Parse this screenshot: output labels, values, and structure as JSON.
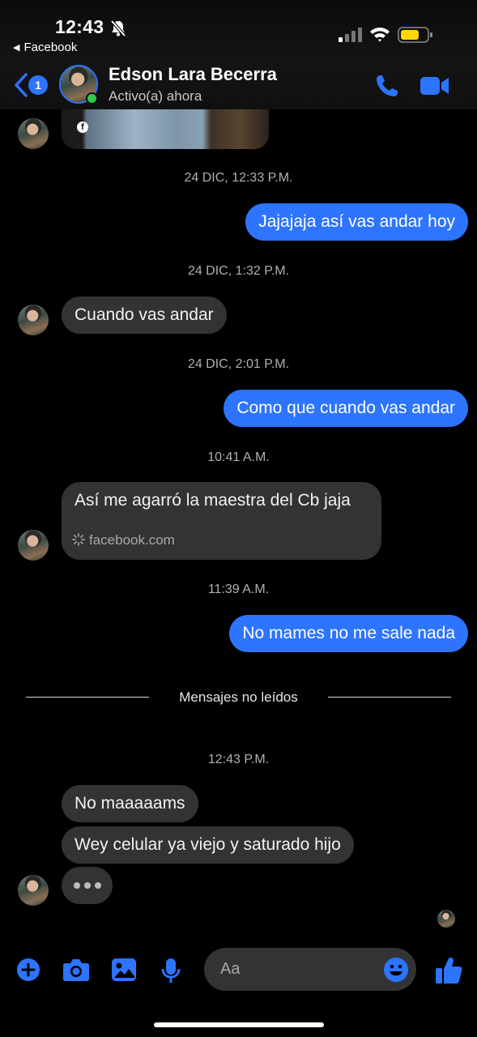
{
  "status_bar": {
    "time": "12:43",
    "back_app": "Facebook"
  },
  "header": {
    "unread_count": "1",
    "contact_name": "Edson Lara Becerra",
    "contact_status": "Activo(a) ahora"
  },
  "messages": {
    "ts1": "24 DIC, 12:33 P.M.",
    "m1": "Jajajaja así vas andar hoy",
    "ts2": "24 DIC, 1:32 P.M.",
    "m2": "Cuando vas andar",
    "ts3": "24 DIC, 2:01 P.M.",
    "m3": "Como que cuando vas andar",
    "ts4": "10:41 A.M.",
    "m4_text": "Así me agarró la maestra del Cb jaja",
    "m4_domain": "facebook.com",
    "ts5": "11:39 A.M.",
    "m5": "No mames no me sale nada",
    "unread_divider": "Mensajes no leídos",
    "ts6": "12:43 P.M.",
    "m6": "No maaaaams",
    "m7": "Wey celular ya viejo y saturado hijo"
  },
  "composer": {
    "placeholder": "Aa"
  },
  "colors": {
    "accent": "#2d74ff",
    "incoming_bubble": "#333336",
    "online": "#31cc46",
    "battery": "#ffd60a"
  }
}
